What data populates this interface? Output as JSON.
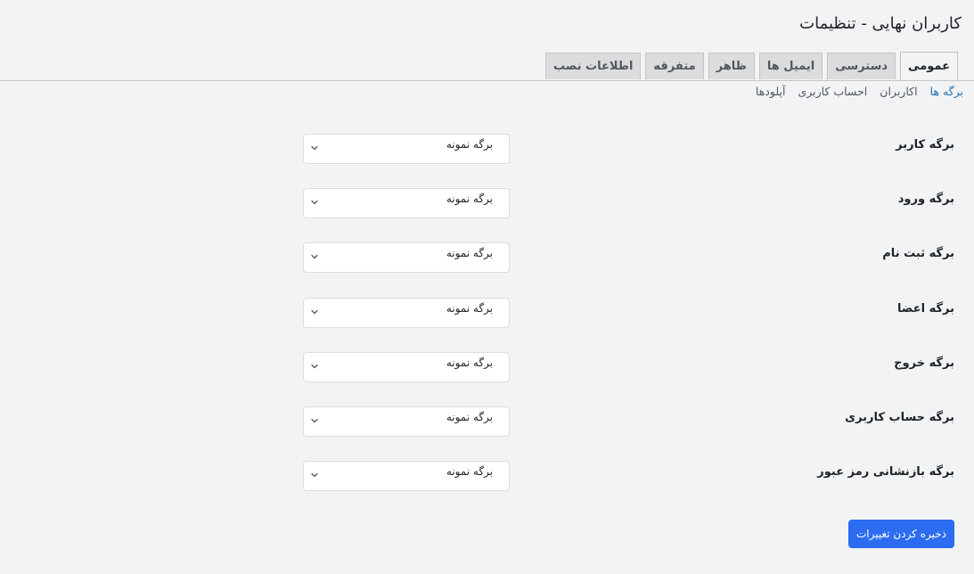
{
  "header": {
    "title": "کاربران نهایی - تنظیمات"
  },
  "tabs": [
    {
      "label": "عمومی",
      "active": true
    },
    {
      "label": "دسترسی",
      "active": false
    },
    {
      "label": "ایمیل ها",
      "active": false
    },
    {
      "label": "ظاهر",
      "active": false
    },
    {
      "label": "متفرقه",
      "active": false
    },
    {
      "label": "اطلاعات نصب",
      "active": false
    }
  ],
  "subnav": {
    "items": [
      {
        "label": "برگه ها",
        "current": true
      },
      {
        "label": "اکاربران",
        "current": false
      },
      {
        "label": "احساب کاربری",
        "current": false
      },
      {
        "label": "آپلودها",
        "current": false
      }
    ]
  },
  "fields": [
    {
      "label": "برگه کاربر",
      "value": "برگه نمونه"
    },
    {
      "label": "برگه ورود",
      "value": "برگه نمونه"
    },
    {
      "label": "برگه ثبت نام",
      "value": "برگه نمونه"
    },
    {
      "label": "برگه اعضا",
      "value": "برگه نمونه"
    },
    {
      "label": "برگه خروج",
      "value": "برگه نمونه"
    },
    {
      "label": "برگه حساب کاربری",
      "value": "برگه نمونه"
    },
    {
      "label": "برگه بازنشانی رمز عبور",
      "value": "برگه نمونه"
    }
  ],
  "actions": {
    "save_label": "ذخیره کردن تغییرات"
  },
  "colors": {
    "accent": "#2b6cf0",
    "link": "#2271b1",
    "background": "#f2f3f5"
  },
  "icons": {
    "select_caret": "chevron-down-icon"
  }
}
